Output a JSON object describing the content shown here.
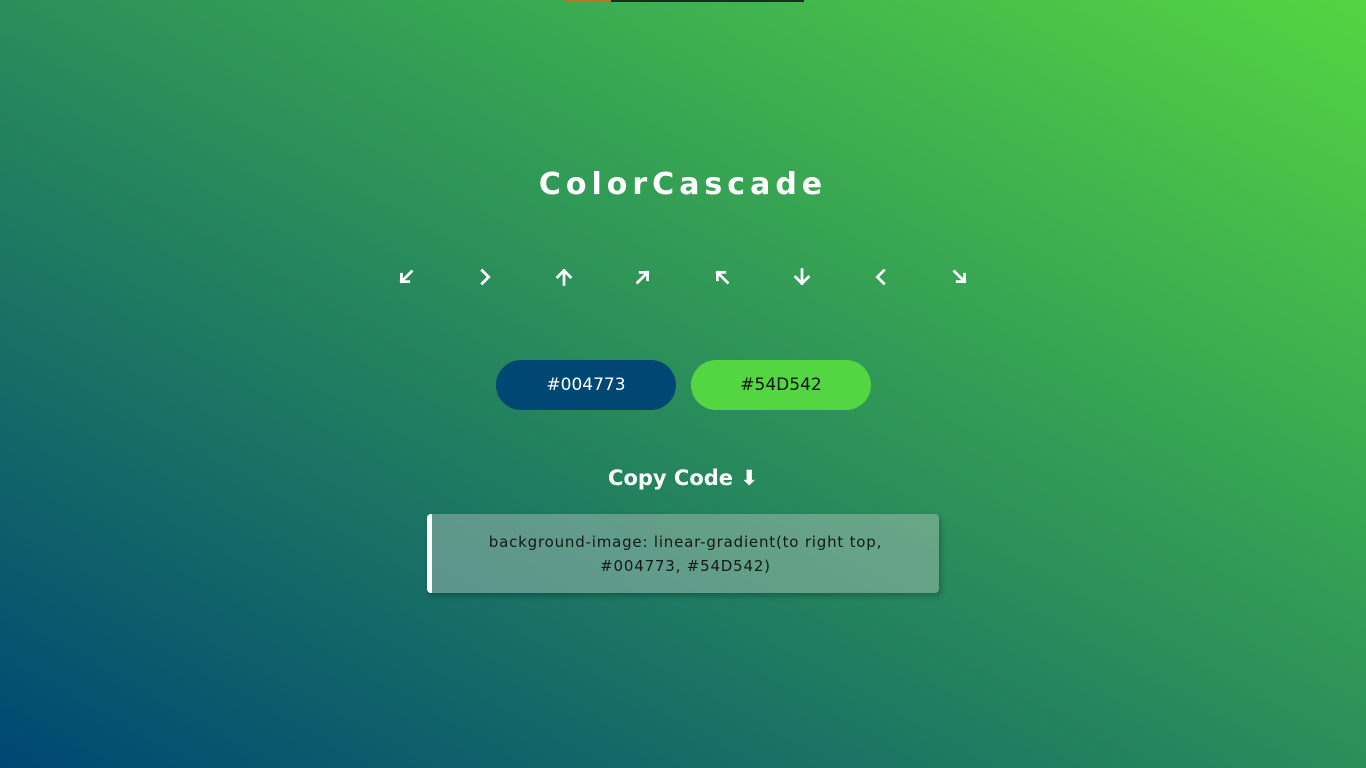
{
  "app": {
    "title": "ColorCascade"
  },
  "directions": [
    {
      "name": "to-bottom-left",
      "icon": "arrow-down-left-icon"
    },
    {
      "name": "to-right",
      "icon": "chevron-right-icon"
    },
    {
      "name": "to-top",
      "icon": "arrow-up-icon"
    },
    {
      "name": "to-right-top",
      "icon": "arrow-up-right-icon"
    },
    {
      "name": "to-left-top",
      "icon": "arrow-up-left-icon"
    },
    {
      "name": "to-bottom",
      "icon": "arrow-down-icon"
    },
    {
      "name": "to-left",
      "icon": "chevron-left-icon"
    },
    {
      "name": "to-bottom-right",
      "icon": "arrow-down-right-icon"
    }
  ],
  "colors": {
    "first": {
      "label": "#004773",
      "background": "#004773",
      "text_color": "#ffffff"
    },
    "second": {
      "label": "#54D542",
      "background": "#54D542",
      "text_color": "#111111"
    }
  },
  "copy": {
    "heading": "Copy Code ⬇",
    "code": "background-image: linear-gradient(to right top, #004773, #54D542)"
  }
}
